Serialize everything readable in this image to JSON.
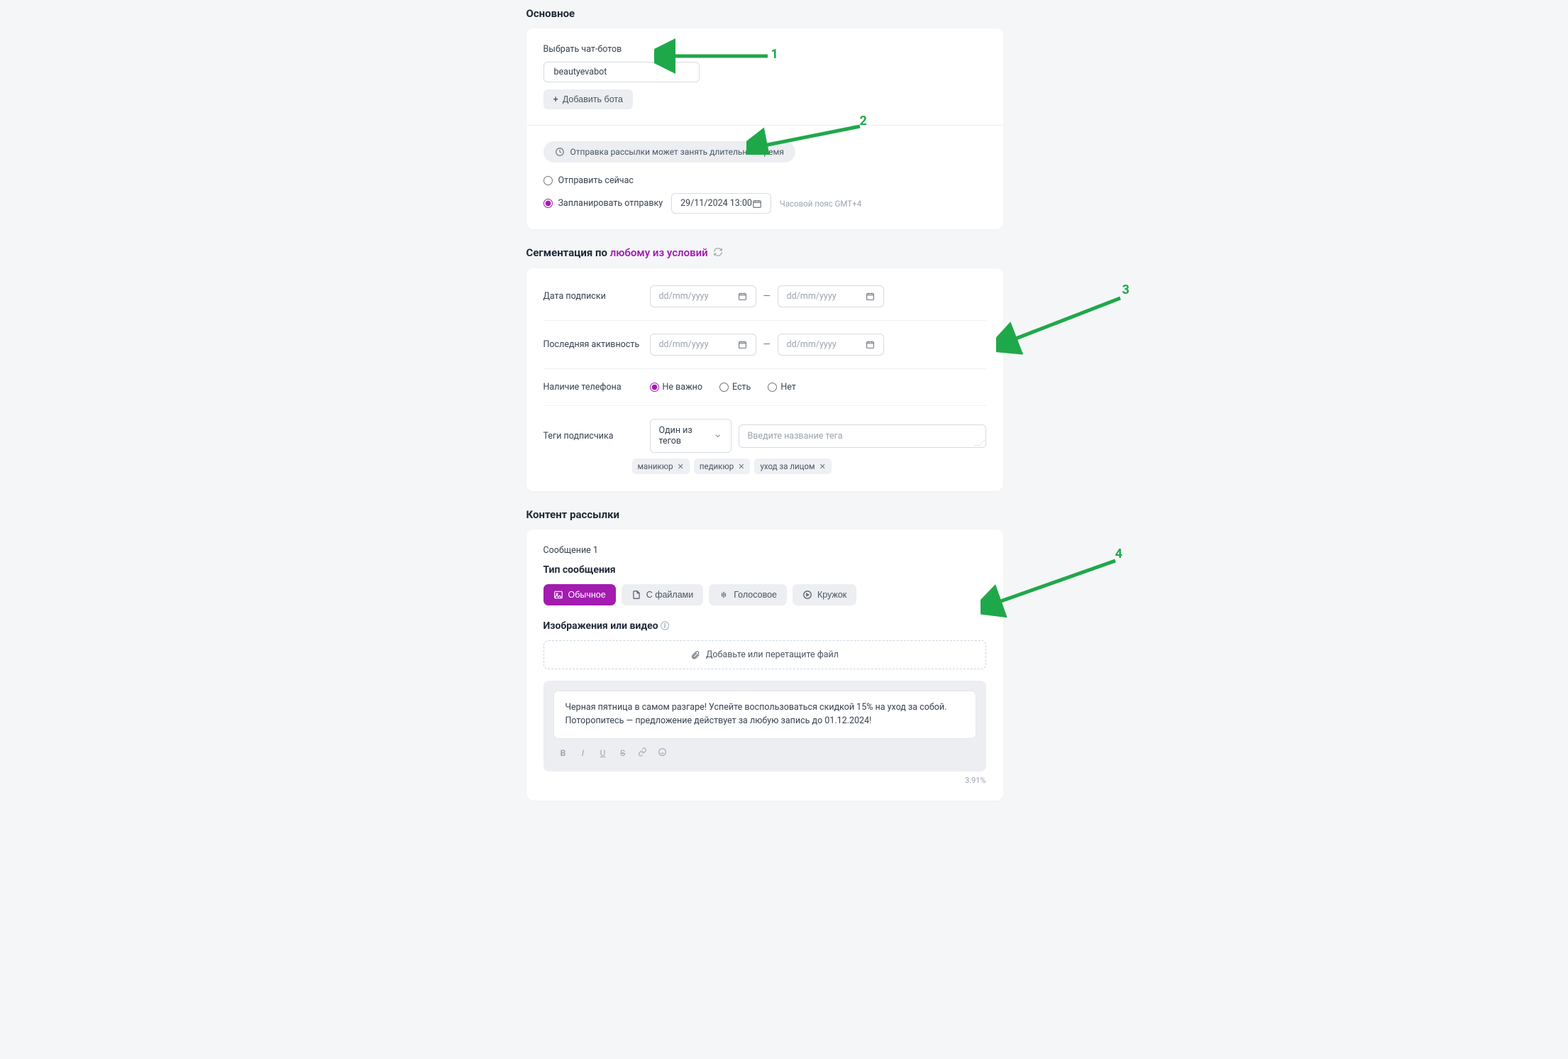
{
  "sections": {
    "main": "Основное",
    "segmentation_prefix": "Сегментация по ",
    "segmentation_link": "любому из условий",
    "content": "Контент рассылки"
  },
  "bots": {
    "label": "Выбрать чат-ботов",
    "chip": "beautyevabot",
    "add_btn": "Добавить бота"
  },
  "send": {
    "info": "Отправка рассылки может занять длительное время",
    "now": "Отправить сейчас",
    "schedule": "Запланировать отправку",
    "datetime": "29/11/2024 13:00",
    "tz": "Часовой пояс GMT+4"
  },
  "seg": {
    "sub_date": "Дата подписки",
    "last_activity": "Последняя активность",
    "has_phone": "Наличие телефона",
    "tags": "Теги подписчика",
    "date_placeholder": "dd/mm/yyyy",
    "phone_any": "Не важно",
    "phone_yes": "Есть",
    "phone_no": "Нет",
    "tag_mode": "Один из тегов",
    "tag_placeholder": "Введите название тега",
    "tag_list": [
      "маникюр",
      "педикюр",
      "уход за лицом"
    ]
  },
  "content": {
    "msg_n": "Сообщение 1",
    "type_header": "Тип сообщения",
    "types": {
      "normal": "Обычное",
      "files": "С файлами",
      "voice": "Голосовое",
      "circle": "Кружок"
    },
    "media_header": "Изображения или видео",
    "dropzone": "Добавьте или перетащите файл",
    "body": "Черная пятница в самом разгаре! Успейте воспользоваться скидкой 15% на уход за собой. Поторопитесь — предложение действует за любую запись до 01.12.2024!",
    "percent": "3.91%"
  },
  "annotations": {
    "n1": "1",
    "n2": "2",
    "n3": "3",
    "n4": "4"
  }
}
